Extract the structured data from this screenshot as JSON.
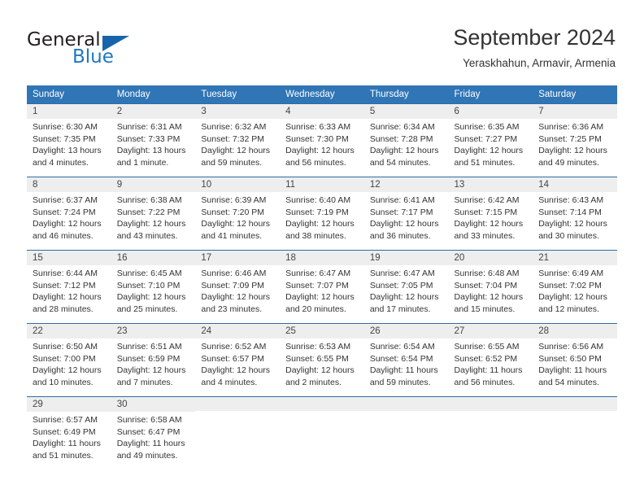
{
  "brand": {
    "name_part1": "General",
    "name_part2": "Blue",
    "logo_icon": "triangle-flag-icon"
  },
  "header": {
    "title": "September 2024",
    "subtitle": "Yeraskhahun, Armavir, Armenia"
  },
  "colors": {
    "header_blue": "#3075b5",
    "rule_blue": "#2e6da4",
    "day_band": "#eeeeee",
    "brand_blue": "#1f78c1"
  },
  "calendar": {
    "weekday_headers": [
      "Sunday",
      "Monday",
      "Tuesday",
      "Wednesday",
      "Thursday",
      "Friday",
      "Saturday"
    ],
    "labels": {
      "sunrise": "Sunrise:",
      "sunset": "Sunset:",
      "daylight": "Daylight:"
    },
    "weeks": [
      [
        {
          "day": "1",
          "sunrise": "Sunrise: 6:30 AM",
          "sunset": "Sunset: 7:35 PM",
          "daylight_l1": "Daylight: 13 hours",
          "daylight_l2": "and 4 minutes."
        },
        {
          "day": "2",
          "sunrise": "Sunrise: 6:31 AM",
          "sunset": "Sunset: 7:33 PM",
          "daylight_l1": "Daylight: 13 hours",
          "daylight_l2": "and 1 minute."
        },
        {
          "day": "3",
          "sunrise": "Sunrise: 6:32 AM",
          "sunset": "Sunset: 7:32 PM",
          "daylight_l1": "Daylight: 12 hours",
          "daylight_l2": "and 59 minutes."
        },
        {
          "day": "4",
          "sunrise": "Sunrise: 6:33 AM",
          "sunset": "Sunset: 7:30 PM",
          "daylight_l1": "Daylight: 12 hours",
          "daylight_l2": "and 56 minutes."
        },
        {
          "day": "5",
          "sunrise": "Sunrise: 6:34 AM",
          "sunset": "Sunset: 7:28 PM",
          "daylight_l1": "Daylight: 12 hours",
          "daylight_l2": "and 54 minutes."
        },
        {
          "day": "6",
          "sunrise": "Sunrise: 6:35 AM",
          "sunset": "Sunset: 7:27 PM",
          "daylight_l1": "Daylight: 12 hours",
          "daylight_l2": "and 51 minutes."
        },
        {
          "day": "7",
          "sunrise": "Sunrise: 6:36 AM",
          "sunset": "Sunset: 7:25 PM",
          "daylight_l1": "Daylight: 12 hours",
          "daylight_l2": "and 49 minutes."
        }
      ],
      [
        {
          "day": "8",
          "sunrise": "Sunrise: 6:37 AM",
          "sunset": "Sunset: 7:24 PM",
          "daylight_l1": "Daylight: 12 hours",
          "daylight_l2": "and 46 minutes."
        },
        {
          "day": "9",
          "sunrise": "Sunrise: 6:38 AM",
          "sunset": "Sunset: 7:22 PM",
          "daylight_l1": "Daylight: 12 hours",
          "daylight_l2": "and 43 minutes."
        },
        {
          "day": "10",
          "sunrise": "Sunrise: 6:39 AM",
          "sunset": "Sunset: 7:20 PM",
          "daylight_l1": "Daylight: 12 hours",
          "daylight_l2": "and 41 minutes."
        },
        {
          "day": "11",
          "sunrise": "Sunrise: 6:40 AM",
          "sunset": "Sunset: 7:19 PM",
          "daylight_l1": "Daylight: 12 hours",
          "daylight_l2": "and 38 minutes."
        },
        {
          "day": "12",
          "sunrise": "Sunrise: 6:41 AM",
          "sunset": "Sunset: 7:17 PM",
          "daylight_l1": "Daylight: 12 hours",
          "daylight_l2": "and 36 minutes."
        },
        {
          "day": "13",
          "sunrise": "Sunrise: 6:42 AM",
          "sunset": "Sunset: 7:15 PM",
          "daylight_l1": "Daylight: 12 hours",
          "daylight_l2": "and 33 minutes."
        },
        {
          "day": "14",
          "sunrise": "Sunrise: 6:43 AM",
          "sunset": "Sunset: 7:14 PM",
          "daylight_l1": "Daylight: 12 hours",
          "daylight_l2": "and 30 minutes."
        }
      ],
      [
        {
          "day": "15",
          "sunrise": "Sunrise: 6:44 AM",
          "sunset": "Sunset: 7:12 PM",
          "daylight_l1": "Daylight: 12 hours",
          "daylight_l2": "and 28 minutes."
        },
        {
          "day": "16",
          "sunrise": "Sunrise: 6:45 AM",
          "sunset": "Sunset: 7:10 PM",
          "daylight_l1": "Daylight: 12 hours",
          "daylight_l2": "and 25 minutes."
        },
        {
          "day": "17",
          "sunrise": "Sunrise: 6:46 AM",
          "sunset": "Sunset: 7:09 PM",
          "daylight_l1": "Daylight: 12 hours",
          "daylight_l2": "and 23 minutes."
        },
        {
          "day": "18",
          "sunrise": "Sunrise: 6:47 AM",
          "sunset": "Sunset: 7:07 PM",
          "daylight_l1": "Daylight: 12 hours",
          "daylight_l2": "and 20 minutes."
        },
        {
          "day": "19",
          "sunrise": "Sunrise: 6:47 AM",
          "sunset": "Sunset: 7:05 PM",
          "daylight_l1": "Daylight: 12 hours",
          "daylight_l2": "and 17 minutes."
        },
        {
          "day": "20",
          "sunrise": "Sunrise: 6:48 AM",
          "sunset": "Sunset: 7:04 PM",
          "daylight_l1": "Daylight: 12 hours",
          "daylight_l2": "and 15 minutes."
        },
        {
          "day": "21",
          "sunrise": "Sunrise: 6:49 AM",
          "sunset": "Sunset: 7:02 PM",
          "daylight_l1": "Daylight: 12 hours",
          "daylight_l2": "and 12 minutes."
        }
      ],
      [
        {
          "day": "22",
          "sunrise": "Sunrise: 6:50 AM",
          "sunset": "Sunset: 7:00 PM",
          "daylight_l1": "Daylight: 12 hours",
          "daylight_l2": "and 10 minutes."
        },
        {
          "day": "23",
          "sunrise": "Sunrise: 6:51 AM",
          "sunset": "Sunset: 6:59 PM",
          "daylight_l1": "Daylight: 12 hours",
          "daylight_l2": "and 7 minutes."
        },
        {
          "day": "24",
          "sunrise": "Sunrise: 6:52 AM",
          "sunset": "Sunset: 6:57 PM",
          "daylight_l1": "Daylight: 12 hours",
          "daylight_l2": "and 4 minutes."
        },
        {
          "day": "25",
          "sunrise": "Sunrise: 6:53 AM",
          "sunset": "Sunset: 6:55 PM",
          "daylight_l1": "Daylight: 12 hours",
          "daylight_l2": "and 2 minutes."
        },
        {
          "day": "26",
          "sunrise": "Sunrise: 6:54 AM",
          "sunset": "Sunset: 6:54 PM",
          "daylight_l1": "Daylight: 11 hours",
          "daylight_l2": "and 59 minutes."
        },
        {
          "day": "27",
          "sunrise": "Sunrise: 6:55 AM",
          "sunset": "Sunset: 6:52 PM",
          "daylight_l1": "Daylight: 11 hours",
          "daylight_l2": "and 56 minutes."
        },
        {
          "day": "28",
          "sunrise": "Sunrise: 6:56 AM",
          "sunset": "Sunset: 6:50 PM",
          "daylight_l1": "Daylight: 11 hours",
          "daylight_l2": "and 54 minutes."
        }
      ],
      [
        {
          "day": "29",
          "sunrise": "Sunrise: 6:57 AM",
          "sunset": "Sunset: 6:49 PM",
          "daylight_l1": "Daylight: 11 hours",
          "daylight_l2": "and 51 minutes."
        },
        {
          "day": "30",
          "sunrise": "Sunrise: 6:58 AM",
          "sunset": "Sunset: 6:47 PM",
          "daylight_l1": "Daylight: 11 hours",
          "daylight_l2": "and 49 minutes."
        },
        {
          "day": "",
          "sunrise": "",
          "sunset": "",
          "daylight_l1": "",
          "daylight_l2": ""
        },
        {
          "day": "",
          "sunrise": "",
          "sunset": "",
          "daylight_l1": "",
          "daylight_l2": ""
        },
        {
          "day": "",
          "sunrise": "",
          "sunset": "",
          "daylight_l1": "",
          "daylight_l2": ""
        },
        {
          "day": "",
          "sunrise": "",
          "sunset": "",
          "daylight_l1": "",
          "daylight_l2": ""
        },
        {
          "day": "",
          "sunrise": "",
          "sunset": "",
          "daylight_l1": "",
          "daylight_l2": ""
        }
      ]
    ]
  }
}
